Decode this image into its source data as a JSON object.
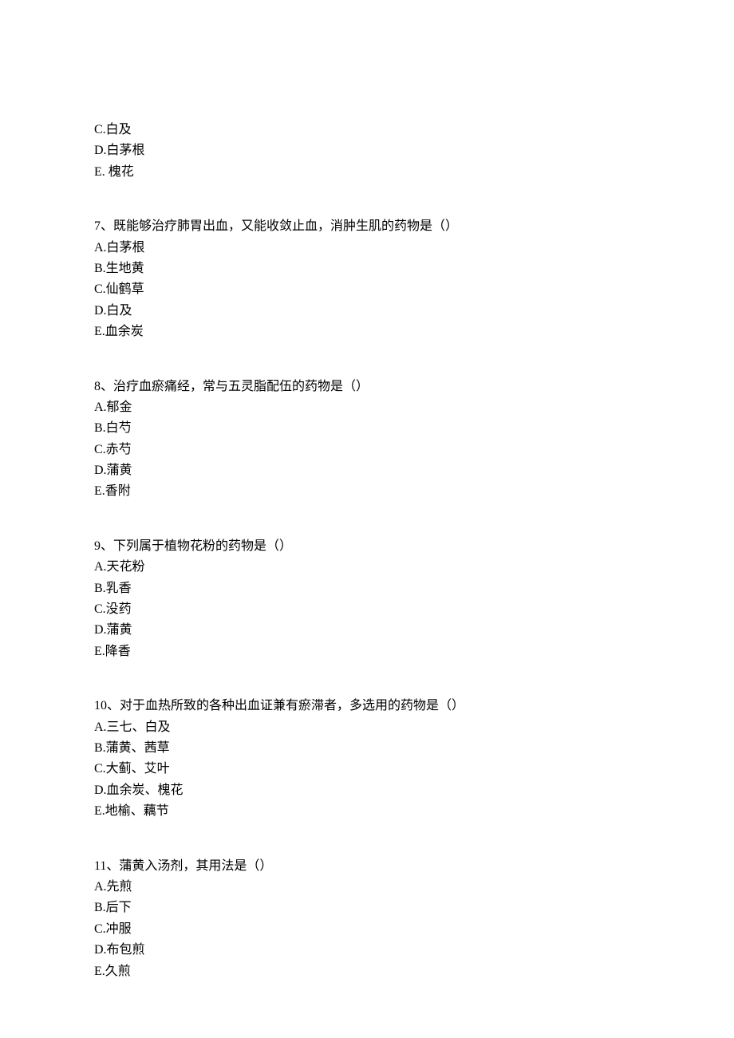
{
  "residual_options": {
    "c": "C.白及",
    "d": "D.白茅根",
    "e": "E. 槐花"
  },
  "questions": [
    {
      "number": "7、",
      "prompt": "既能够治疗肺胃出血，又能收敛止血，消肿生肌的药物是（）",
      "options": {
        "a": "A.白茅根",
        "b": "B.生地黄",
        "c": "C.仙鹤草",
        "d": "D.白及",
        "e": "E.血余炭"
      }
    },
    {
      "number": "8、",
      "prompt": "治疗血瘀痛经，常与五灵脂配伍的药物是（）",
      "options": {
        "a": "A.郁金",
        "b": "B.白芍",
        "c": "C.赤芍",
        "d": "D.蒲黄",
        "e": "E.香附"
      }
    },
    {
      "number": "9、",
      "prompt": "下列属于植物花粉的药物是（）",
      "options": {
        "a": "A.天花粉",
        "b": "B.乳香",
        "c": "C.没药",
        "d": "D.蒲黄",
        "e": "E.降香"
      }
    },
    {
      "number": "10、",
      "prompt": "对于血热所致的各种出血证兼有瘀滞者，多选用的药物是（）",
      "options": {
        "a": "A.三七、白及",
        "b": "B.蒲黄、茜草",
        "c": "C.大蓟、艾叶",
        "d": "D.血余炭、槐花",
        "e": "E.地榆、藕节"
      }
    },
    {
      "number": "11、",
      "prompt": "蒲黄入汤剂，其用法是（）",
      "options": {
        "a": "A.先煎",
        "b": "B.后下",
        "c": "C.冲服",
        "d": "D.布包煎",
        "e": "E.久煎"
      }
    }
  ]
}
